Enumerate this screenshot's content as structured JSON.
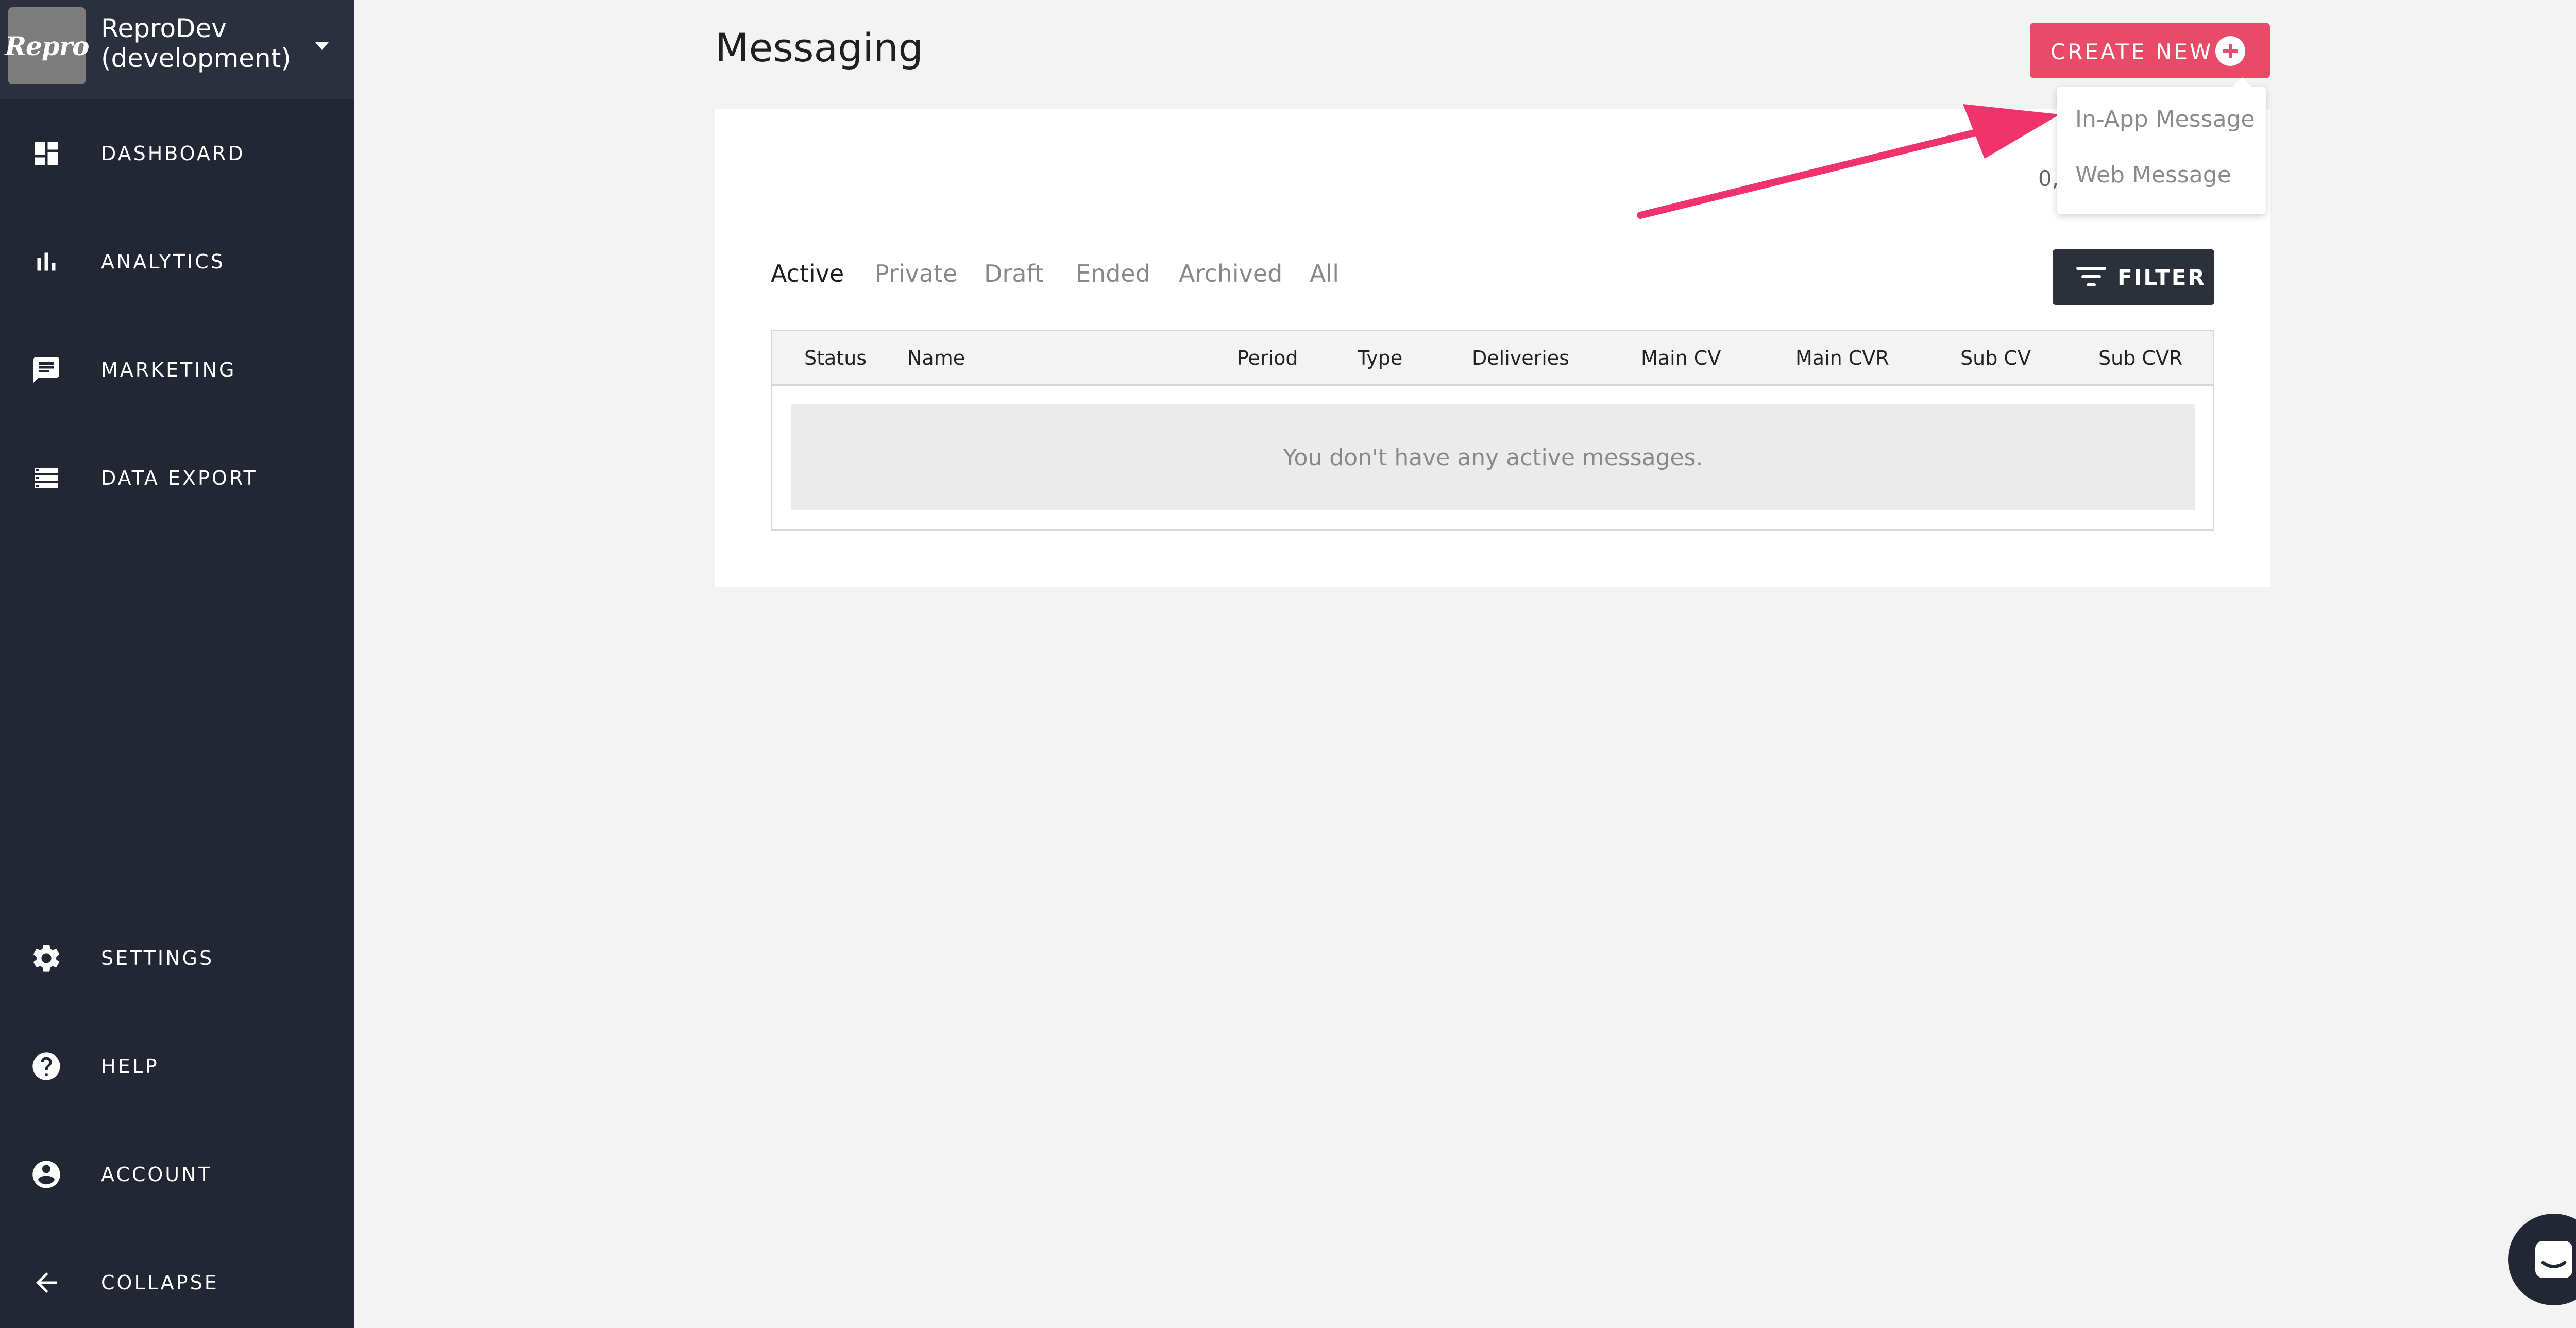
{
  "app": {
    "logo_text": "Repro",
    "name": "ReproDev (development)"
  },
  "sidebar": {
    "items": [
      {
        "label": "DASHBOARD",
        "icon": "dashboard-icon"
      },
      {
        "label": "ANALYTICS",
        "icon": "bar-chart-icon"
      },
      {
        "label": "MARKETING",
        "icon": "message-icon"
      },
      {
        "label": "DATA EXPORT",
        "icon": "list-icon"
      }
    ],
    "bottom_items": [
      {
        "label": "SETTINGS",
        "icon": "gear-icon"
      },
      {
        "label": "HELP",
        "icon": "help-icon"
      },
      {
        "label": "ACCOUNT",
        "icon": "account-icon"
      },
      {
        "label": "COLLAPSE",
        "icon": "arrow-left-icon"
      }
    ]
  },
  "header": {
    "title": "Messaging",
    "create_label": "CREATE NEW"
  },
  "create_menu": {
    "items": [
      "In-App Message",
      "Web Message"
    ]
  },
  "counter_fragment": "0,",
  "tabs": [
    "Active",
    "Private",
    "Draft",
    "Ended",
    "Archived",
    "All"
  ],
  "active_tab": "Active",
  "filter_label": "FILTER",
  "table": {
    "columns": [
      "Status",
      "Name",
      "Period",
      "Type",
      "Deliveries",
      "Main CV",
      "Main CVR",
      "Sub CV",
      "Sub CVR"
    ],
    "empty_message": "You don't have any active messages."
  },
  "colors": {
    "sidebar_bg": "#232733",
    "accent": "#e84b68",
    "annotation": "#f0336d",
    "dark_button": "#2b303b"
  }
}
